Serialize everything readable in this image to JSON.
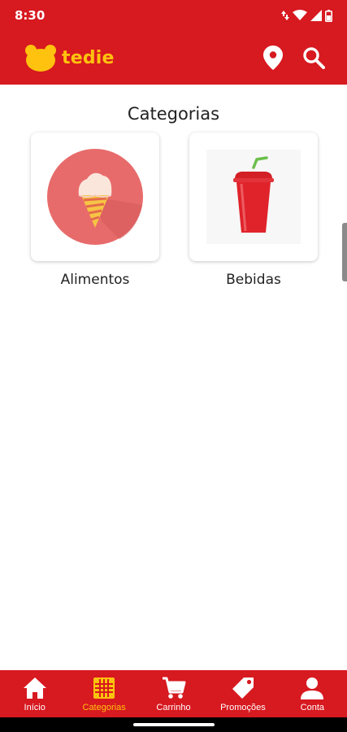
{
  "status_bar": {
    "time": "8:30"
  },
  "header": {
    "brand_name": "tedie",
    "icons": [
      "location-pin-icon",
      "search-icon"
    ]
  },
  "main": {
    "title": "Categorias",
    "categories": [
      {
        "label": "Alimentos",
        "icon": "ice-cream-cone-icon"
      },
      {
        "label": "Bebidas",
        "icon": "soda-cup-icon"
      }
    ]
  },
  "bottom_nav": {
    "items": [
      {
        "label": "Início",
        "icon": "home-icon",
        "active": false
      },
      {
        "label": "Categorias",
        "icon": "grid-icon",
        "active": true
      },
      {
        "label": "Carrinho",
        "icon": "cart-icon",
        "active": false
      },
      {
        "label": "Promoções",
        "icon": "tag-icon",
        "active": false
      },
      {
        "label": "Conta",
        "icon": "person-icon",
        "active": false
      }
    ]
  },
  "colors": {
    "brand_red": "#d71920",
    "brand_yellow": "#ffc20e",
    "text": "#222222"
  }
}
